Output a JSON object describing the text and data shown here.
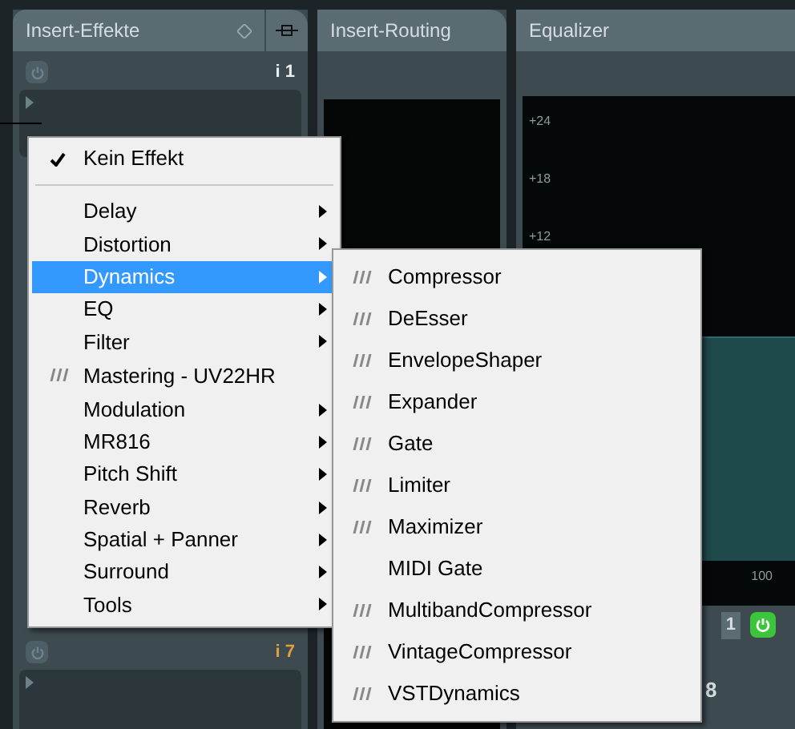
{
  "tabs": [
    {
      "label": "Insert-Effekte"
    },
    {
      "label": "Insert-Routing"
    },
    {
      "label": "Equalizer"
    }
  ],
  "slots": [
    {
      "label": "i 1",
      "color": "#e8eef0"
    },
    {
      "label": "i 7",
      "color": "#e0a040"
    }
  ],
  "equalizer": {
    "y_labels": [
      "+24",
      "+18",
      "+12"
    ],
    "x_label": "100",
    "channel_label": "1",
    "meter_value": "8",
    "power_on": true
  },
  "menu": [
    {
      "kind": "check",
      "label": "Kein Effekt",
      "checked": true
    },
    {
      "kind": "separator"
    },
    {
      "kind": "submenu",
      "label": "Delay",
      "selected": false
    },
    {
      "kind": "submenu",
      "label": "Distortion",
      "selected": false
    },
    {
      "kind": "submenu",
      "label": "Dynamics",
      "selected": true
    },
    {
      "kind": "submenu",
      "label": "EQ",
      "selected": false
    },
    {
      "kind": "submenu",
      "label": "Filter",
      "selected": false
    },
    {
      "kind": "plugin",
      "label": "Mastering - UV22HR"
    },
    {
      "kind": "submenu",
      "label": "Modulation",
      "selected": false
    },
    {
      "kind": "submenu",
      "label": "MR816",
      "selected": false
    },
    {
      "kind": "submenu",
      "label": "Pitch Shift",
      "selected": false
    },
    {
      "kind": "submenu",
      "label": "Reverb",
      "selected": false
    },
    {
      "kind": "submenu",
      "label": "Spatial + Panner",
      "selected": false
    },
    {
      "kind": "submenu",
      "label": "Surround",
      "selected": false
    },
    {
      "kind": "submenu",
      "label": "Tools",
      "selected": false
    }
  ],
  "submenu": [
    {
      "kind": "plugin",
      "label": "Compressor"
    },
    {
      "kind": "plugin",
      "label": "DeEsser"
    },
    {
      "kind": "plugin",
      "label": "EnvelopeShaper"
    },
    {
      "kind": "plugin",
      "label": "Expander"
    },
    {
      "kind": "plugin",
      "label": "Gate"
    },
    {
      "kind": "plugin",
      "label": "Limiter"
    },
    {
      "kind": "plugin",
      "label": "Maximizer"
    },
    {
      "kind": "plain",
      "label": "MIDI Gate"
    },
    {
      "kind": "plugin",
      "label": "MultibandCompressor"
    },
    {
      "kind": "plugin",
      "label": "VintageCompressor"
    },
    {
      "kind": "plugin",
      "label": "VSTDynamics"
    }
  ]
}
